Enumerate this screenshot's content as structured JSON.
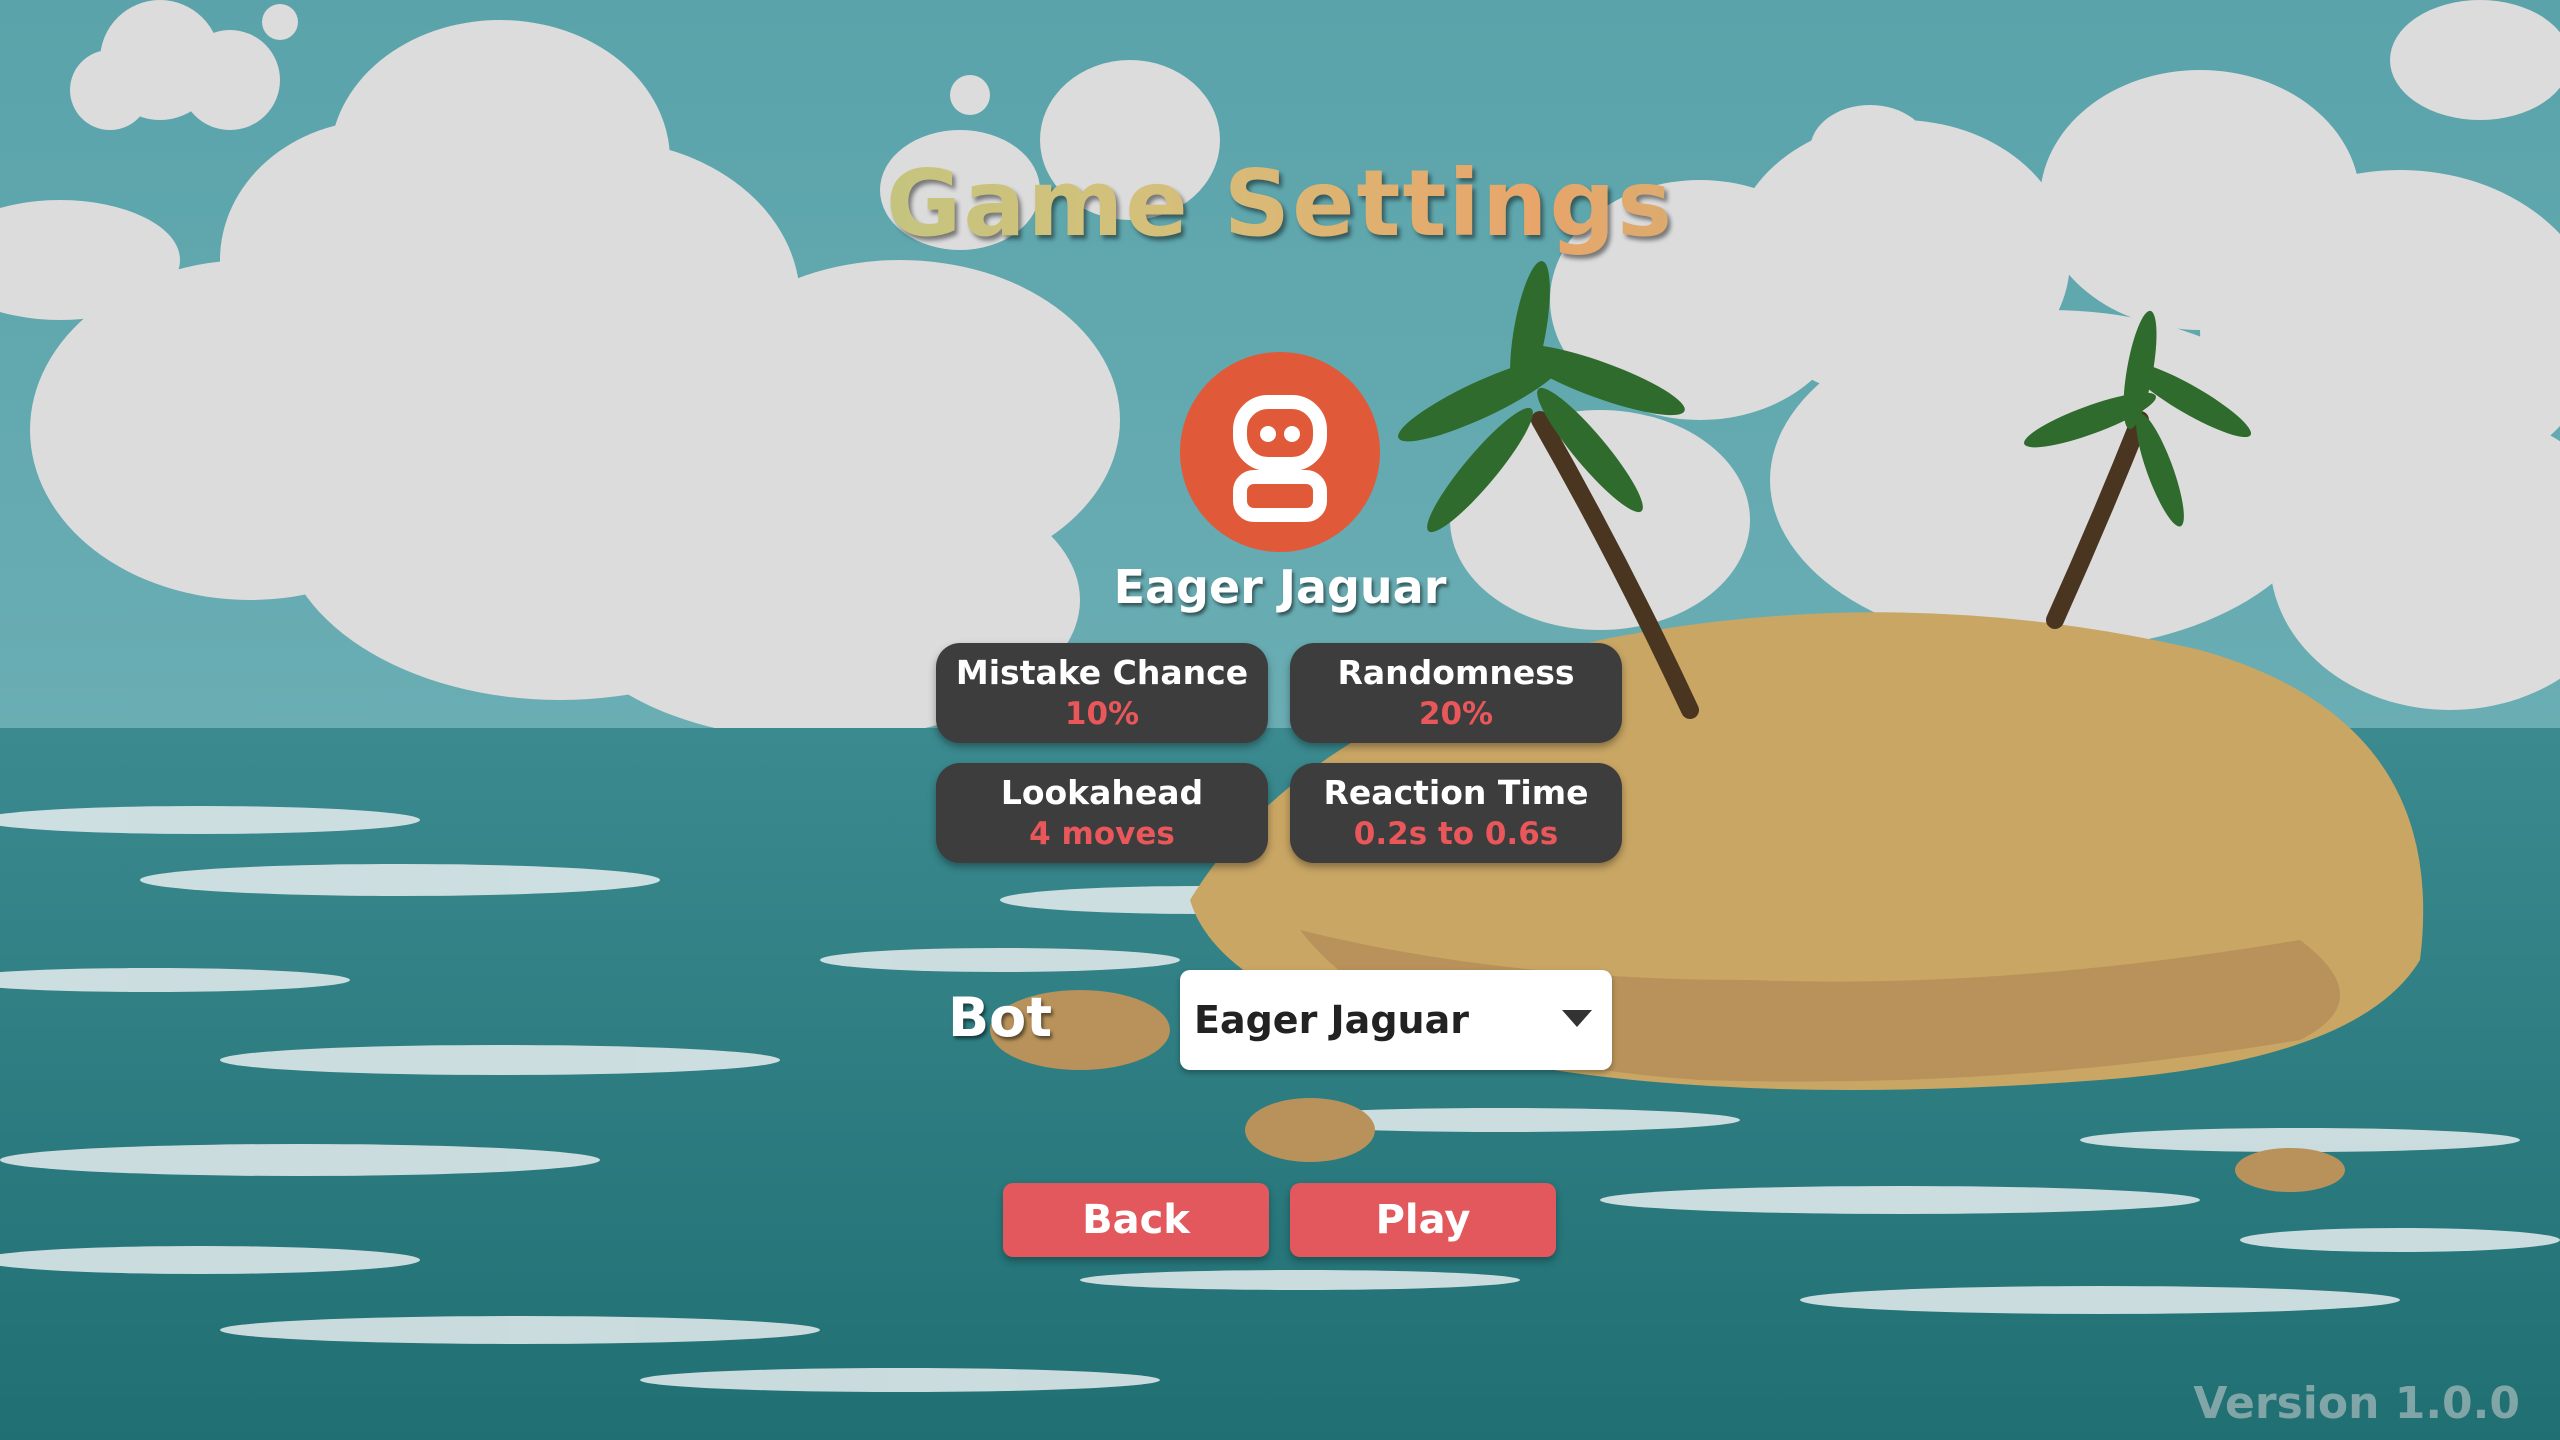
{
  "screen": {
    "title": "Game Settings",
    "version": "Version 1.0.0"
  },
  "bot_card": {
    "avatar_icon": "robot-icon",
    "avatar_color": "#e05a3a",
    "name": "Eager Jaguar"
  },
  "stats": [
    {
      "label": "Mistake Chance",
      "value": "10%"
    },
    {
      "label": "Randomness",
      "value": "20%"
    },
    {
      "label": "Lookahead",
      "value": "4 moves"
    },
    {
      "label": "Reaction Time",
      "value": "0.2s to 0.6s"
    }
  ],
  "bot_select": {
    "label": "Bot",
    "selected": "Eager Jaguar",
    "icon": "chevron-down-icon"
  },
  "buttons": {
    "back": "Back",
    "play": "Play"
  },
  "colors": {
    "stat_value": "#e9575a",
    "button": "#e2585c",
    "stat_card": "#3d3d3d",
    "sea": "#2b7d80",
    "sky": "#5ba4ab",
    "sand": "#c9a664"
  }
}
